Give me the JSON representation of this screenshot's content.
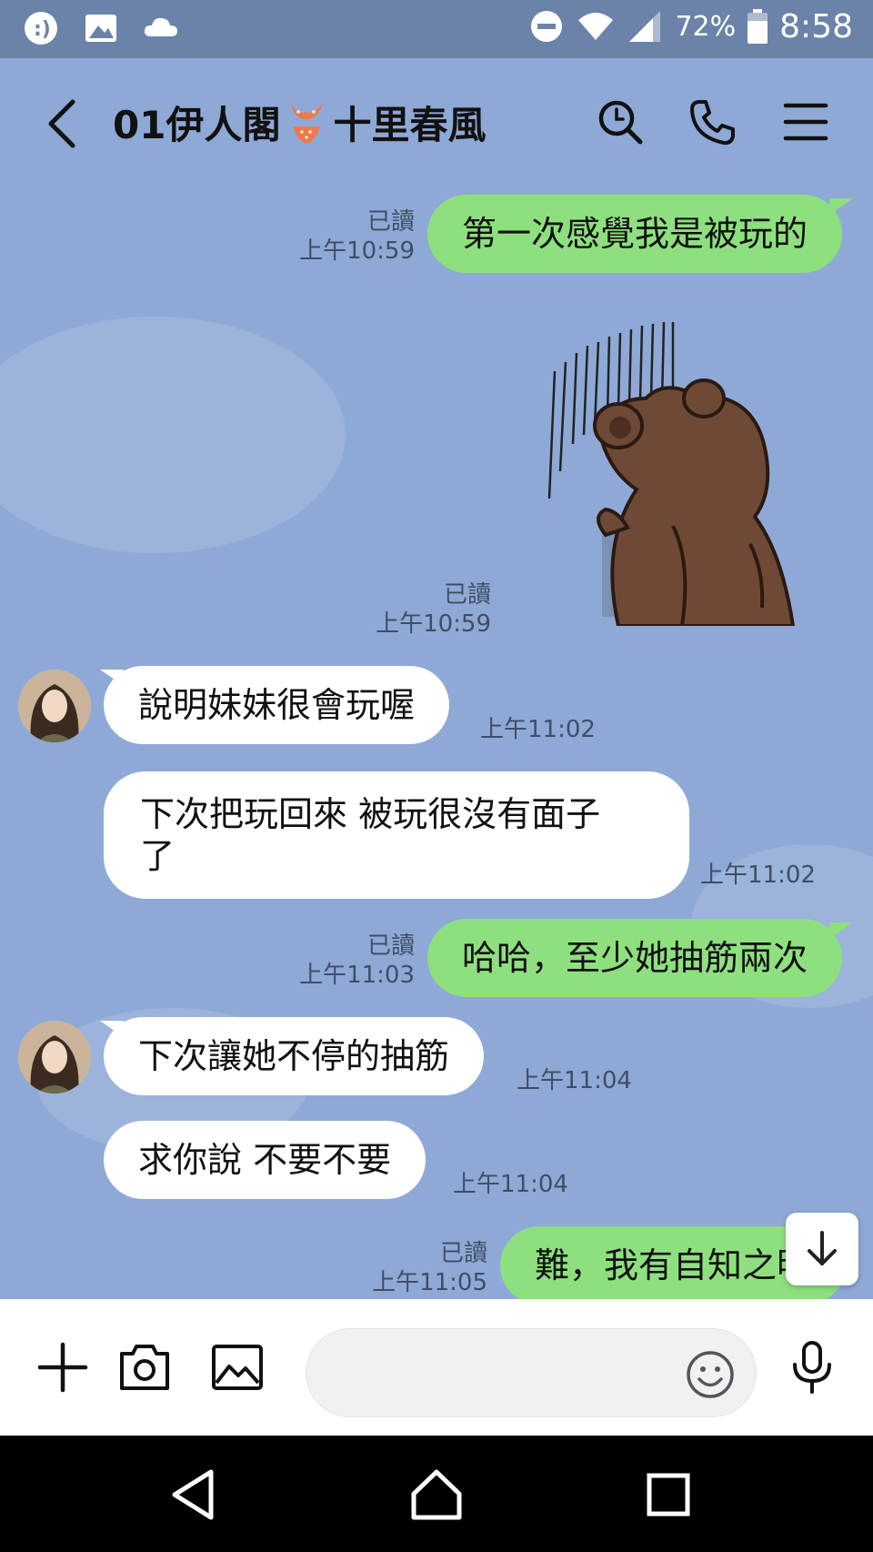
{
  "status_bar": {
    "left_icons": [
      "assistant-icon",
      "image-icon",
      "cloud-icon"
    ],
    "battery_percent": "72%",
    "time": "8:58"
  },
  "header": {
    "title_part1": "01伊人閣",
    "title_part2": "十里春風"
  },
  "messages": [
    {
      "id": "m1",
      "side": "out",
      "text": "第一次感覺我是被玩的",
      "read": "已讀",
      "time": "上午10:59"
    },
    {
      "id": "m2",
      "side": "out",
      "type": "sticker",
      "sticker": "bear-facing-wall",
      "read": "已讀",
      "time": "上午10:59"
    },
    {
      "id": "m3",
      "side": "in",
      "text": "說明妹妹很會玩喔",
      "time": "上午11:02"
    },
    {
      "id": "m4",
      "side": "in",
      "text_line1": "下次把玩回來 被玩很沒有面子",
      "text_line2": "了",
      "time": "上午11:02"
    },
    {
      "id": "m5",
      "side": "out",
      "text": "哈哈，至少她抽筋兩次",
      "read": "已讀",
      "time": "上午11:03"
    },
    {
      "id": "m6",
      "side": "in",
      "text": "下次讓她不停的抽筋",
      "time": "上午11:04"
    },
    {
      "id": "m7",
      "side": "in",
      "text": "求你說 不要不要",
      "time": "上午11:04"
    },
    {
      "id": "m8",
      "side": "out",
      "text": "難，我有自知之明",
      "read": "已讀",
      "time": "上午11:05"
    }
  ],
  "input": {
    "placeholder": "",
    "value": ""
  },
  "colors": {
    "chat_background": "#8fa9d6",
    "outgoing_bubble": "#8ee07f",
    "incoming_bubble": "#ffffff",
    "status_bar": "#6b83a8"
  }
}
